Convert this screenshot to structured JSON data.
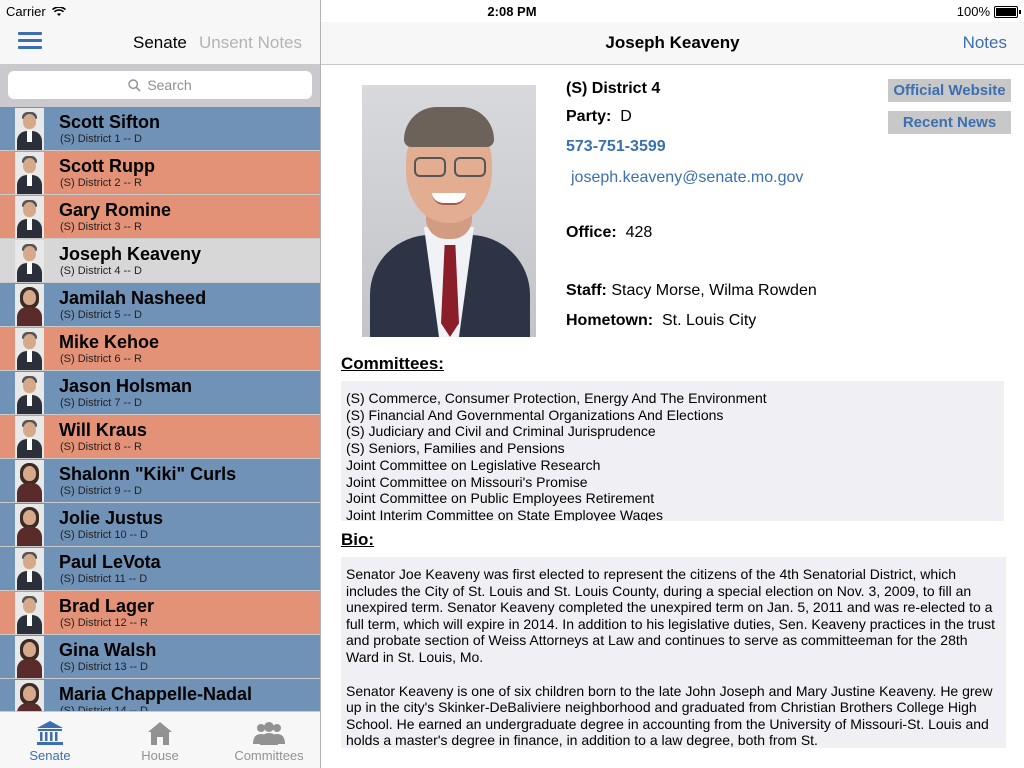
{
  "status_bar": {
    "carrier": "Carrier",
    "time": "2:08 PM",
    "battery": "100%"
  },
  "master": {
    "segments": {
      "senate": "Senate",
      "unsent": "Unsent Notes"
    },
    "search": {
      "placeholder": "Search"
    },
    "senators": [
      {
        "name": "Scott Sifton",
        "district": "(S) District 1 -- D",
        "party": "D"
      },
      {
        "name": "Scott Rupp",
        "district": "(S) District 2 -- R",
        "party": "R"
      },
      {
        "name": "Gary Romine",
        "district": "(S) District 3 -- R",
        "party": "R"
      },
      {
        "name": "Joseph Keaveny",
        "district": "(S) District 4 -- D",
        "party": "D",
        "selected": true
      },
      {
        "name": "Jamilah Nasheed",
        "district": "(S) District 5 -- D",
        "party": "D",
        "female": true
      },
      {
        "name": "Mike Kehoe",
        "district": "(S) District 6 -- R",
        "party": "R"
      },
      {
        "name": "Jason Holsman",
        "district": "(S) District 7 -- D",
        "party": "D"
      },
      {
        "name": "Will Kraus",
        "district": "(S) District 8 -- R",
        "party": "R"
      },
      {
        "name": "Shalonn \"Kiki\" Curls",
        "district": "(S) District 9 -- D",
        "party": "D",
        "female": true
      },
      {
        "name": "Jolie Justus",
        "district": "(S) District 10 -- D",
        "party": "D",
        "female": true
      },
      {
        "name": "Paul LeVota",
        "district": "(S) District 11 -- D",
        "party": "D"
      },
      {
        "name": "Brad Lager",
        "district": "(S) District 12 -- R",
        "party": "R"
      },
      {
        "name": "Gina Walsh",
        "district": "(S) District 13 -- D",
        "party": "D",
        "female": true
      },
      {
        "name": "Maria Chappelle-Nadal",
        "district": "(S) District 14 -- D",
        "party": "D",
        "female": true
      }
    ],
    "tabs": [
      {
        "label": "Senate",
        "icon": "capitol-icon",
        "active": true
      },
      {
        "label": "House",
        "icon": "house-icon",
        "active": false
      },
      {
        "label": "Committees",
        "icon": "people-icon",
        "active": false
      }
    ]
  },
  "detail": {
    "title": "Joseph Keaveny",
    "notes_label": "Notes",
    "district": "(S) District 4",
    "party_label": "Party:",
    "party": "D",
    "phone": "573-751-3599",
    "email": "joseph.keaveny@senate.mo.gov",
    "office_label": "Office:",
    "office": "428",
    "staff_label": "Staff:",
    "staff": "Stacy Morse, Wilma Rowden",
    "hometown_label": "Hometown:",
    "hometown": "St. Louis City",
    "official_website_label": "Official Website",
    "recent_news_label": "Recent News",
    "committees_label": "Committees:",
    "committees": [
      "(S) Commerce, Consumer Protection, Energy And The Environment",
      "(S) Financial And Governmental Organizations And Elections",
      "(S) Judiciary and Civil and Criminal Jurisprudence",
      "(S) Seniors, Families and Pensions",
      "Joint Committee on Legislative Research",
      "Joint Committee on Missouri's Promise",
      "Joint Committee on Public Employees Retirement",
      "Joint Interim Committee on State Employee Wages"
    ],
    "bio_label": "Bio:",
    "bio": [
      "Senator Joe Keaveny was first elected to represent the citizens of the 4th Senatorial District, which includes the City of St. Louis and St. Louis County, during a special election on Nov. 3, 2009, to fill an unexpired term. Senator Keaveny completed the unexpired term on Jan. 5, 2011 and was re-elected to a full term, which will expire in 2014. In addition to his legislative duties, Sen. Keaveny practices in the trust and probate section of Weiss Attorneys at Law and continues to serve as committeeman for the 28th Ward in St. Louis, Mo.",
      "Senator Keaveny is one of six children born to the late John Joseph and Mary Justine Keaveny. He grew up in the city's Skinker-DeBaliviere neighborhood and graduated from Christian Brothers College High School. He earned an undergraduate degree in accounting from the University of Missouri-St. Louis and holds a master's degree in finance, in addition to a law degree, both from St."
    ]
  },
  "colors": {
    "democrat_row": "#7092b7",
    "republican_row": "#e49277",
    "selected_row": "#d7d7d7",
    "accent": "#3b6fb1"
  }
}
